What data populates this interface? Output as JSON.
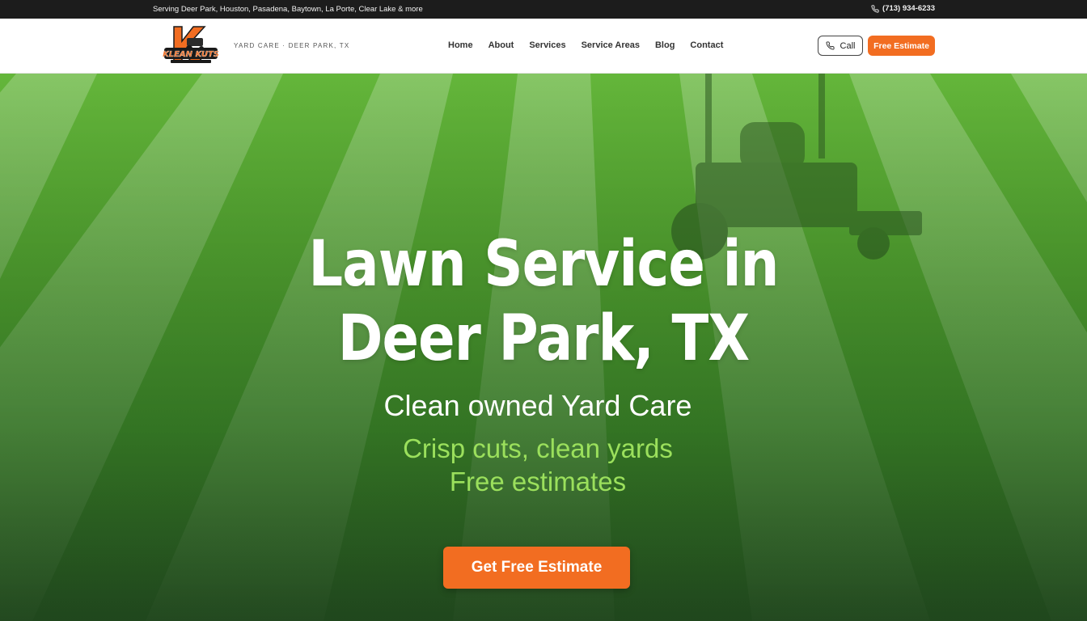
{
  "topbar": {
    "service_areas": "Serving Deer Park, Houston, Pasadena, Baytown, La Porte, Clear Lake & more",
    "phone": "(713) 934-6233"
  },
  "header": {
    "logo_text": "KLEAN KUTS",
    "tagline": "YARD CARE · DEER PARK, TX",
    "nav": [
      "Home",
      "About",
      "Services",
      "Service Areas",
      "Blog",
      "Contact"
    ],
    "call_label": "Call",
    "estimate_label": "Free Estimate"
  },
  "hero": {
    "title_line1": "Lawn Service in",
    "title_line2": "Deer Park, TX",
    "subtitle": "Clean owned Yard Care",
    "tagline_line1": "Crisp cuts, clean yards",
    "tagline_line2": "Free estimates",
    "cta_label": "Get Free Estimate"
  },
  "colors": {
    "accent": "#f26d21",
    "topbar_bg": "#1c1c1c",
    "tagline_green": "#9be05c",
    "grass": "#4f9f2f"
  },
  "icons": {
    "phone": "phone-icon",
    "mower": "lawn-mower-icon"
  }
}
